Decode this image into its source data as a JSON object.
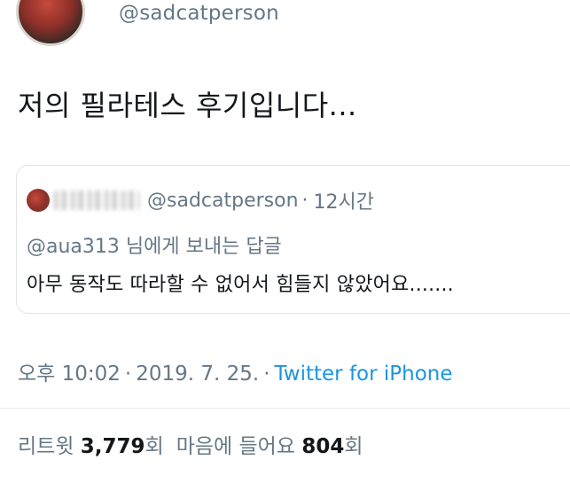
{
  "author": {
    "handle": "@sadcatperson"
  },
  "tweet": {
    "text": "저의 필라테스 후기입니다..."
  },
  "quoted_tweet": {
    "handle": "@sadcatperson",
    "separator": "·",
    "time": "12시간",
    "reply_to": "@aua313 님에게 보내는 답글",
    "text": "아무 동작도 따라할 수 없어서 힘들지 않았어요......."
  },
  "meta": {
    "time": "오후 10:02",
    "separator": "·",
    "date": "2019. 7. 25.",
    "separator2": "·",
    "source": "Twitter for iPhone"
  },
  "stats": {
    "retweets_label": "리트윗",
    "retweets_count": "3,779",
    "retweets_unit": "회",
    "likes_label": "마음에 들어요",
    "likes_count": "804",
    "likes_unit": "회"
  },
  "colors": {
    "text": "#14171a",
    "secondary": "#657786",
    "link": "#1b95e0",
    "border": "#dfe3e6"
  }
}
